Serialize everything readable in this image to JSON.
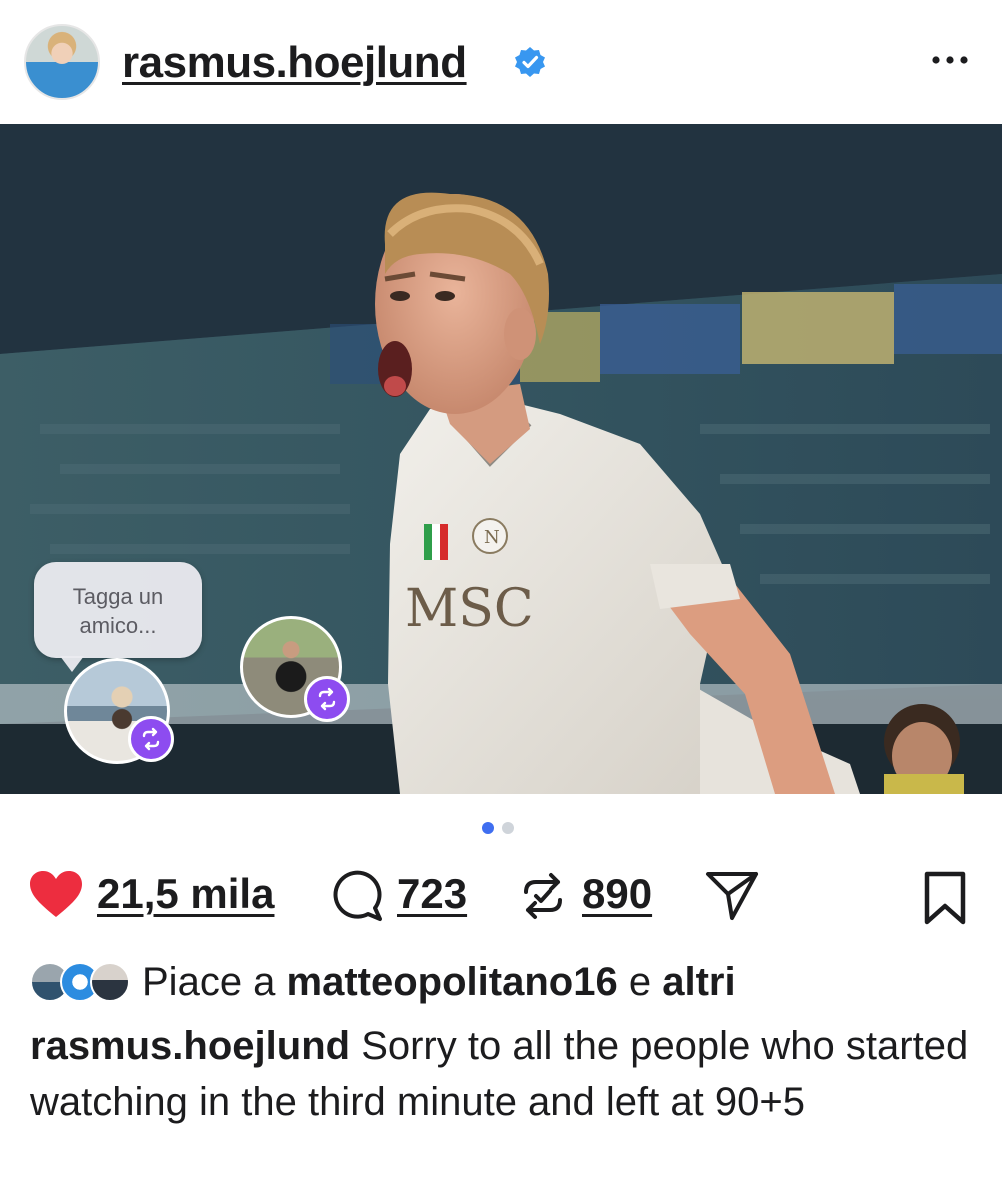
{
  "post": {
    "username": "rasmus.hoejlund",
    "verified": true,
    "more_label": "...",
    "tag_prompt_line1": "Tagga un",
    "tag_prompt_line2": "amico...",
    "jersey_text": "MSC",
    "carousel": {
      "total": 2,
      "active": 1
    }
  },
  "actions": {
    "likes": "21,5 mila",
    "comments": "723",
    "reposts": "890",
    "liked": true
  },
  "likes_row": {
    "prefix": "Piace a",
    "user": "matteopolitano16",
    "connector": "e",
    "others": "altri"
  },
  "caption": {
    "username": "rasmus.hoejlund",
    "text": "Sorry to all the people who started watching in the third minute and left at 90+5"
  },
  "colors": {
    "like_red": "#ed2d3f",
    "verified_blue": "#3897f0",
    "repost_purple": "#8d4cf0",
    "dot_active": "#3f6ef0"
  },
  "icons": [
    "avatar",
    "verified-icon",
    "more-icon",
    "heart-icon",
    "comment-icon",
    "repost-icon",
    "share-icon",
    "bookmark-icon"
  ]
}
